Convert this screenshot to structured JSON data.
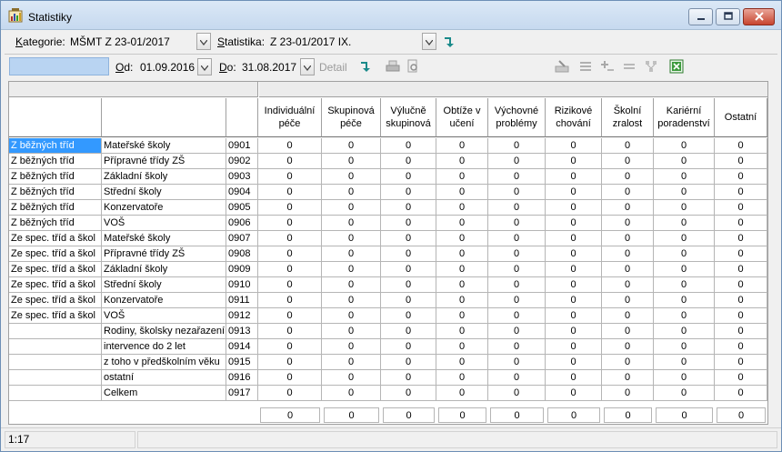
{
  "window": {
    "title": "Statistiky"
  },
  "filters": {
    "category_label": "Kategorie:",
    "category_value": "MŠMT Z 23-01/2017",
    "statistic_label": "Statistika:",
    "statistic_value": "Z 23-01/2017 IX."
  },
  "toolbar": {
    "from_label": "Od:",
    "from_value": "01.09.2016",
    "to_label": "Do:",
    "to_value": "31.08.2017",
    "detail_label": "Detail"
  },
  "table": {
    "columns": [
      "Individuální péče",
      "Skupinová péče",
      "Výlučně skupinová",
      "Obtíže v učení",
      "Výchovné problémy",
      "Rizikové chování",
      "Školní zralost",
      "Kariérní poradenství",
      "Ostatní"
    ],
    "rows": [
      {
        "group": "Z běžných tříd",
        "name": "Mateřské školy",
        "code": "0901",
        "values": [
          "0",
          "0",
          "0",
          "0",
          "0",
          "0",
          "0",
          "0",
          "0"
        ]
      },
      {
        "group": "Z běžných tříd",
        "name": "Přípravné třídy ZŠ",
        "code": "0902",
        "values": [
          "0",
          "0",
          "0",
          "0",
          "0",
          "0",
          "0",
          "0",
          "0"
        ]
      },
      {
        "group": "Z běžných tříd",
        "name": "Základní školy",
        "code": "0903",
        "values": [
          "0",
          "0",
          "0",
          "0",
          "0",
          "0",
          "0",
          "0",
          "0"
        ]
      },
      {
        "group": "Z běžných tříd",
        "name": "Střední školy",
        "code": "0904",
        "values": [
          "0",
          "0",
          "0",
          "0",
          "0",
          "0",
          "0",
          "0",
          "0"
        ]
      },
      {
        "group": "Z běžných tříd",
        "name": "Konzervatoře",
        "code": "0905",
        "values": [
          "0",
          "0",
          "0",
          "0",
          "0",
          "0",
          "0",
          "0",
          "0"
        ]
      },
      {
        "group": "Z běžných tříd",
        "name": "VOŠ",
        "code": "0906",
        "values": [
          "0",
          "0",
          "0",
          "0",
          "0",
          "0",
          "0",
          "0",
          "0"
        ]
      },
      {
        "group": "Ze spec. tříd a škol",
        "name": "Mateřské školy",
        "code": "0907",
        "values": [
          "0",
          "0",
          "0",
          "0",
          "0",
          "0",
          "0",
          "0",
          "0"
        ]
      },
      {
        "group": "Ze spec. tříd a škol",
        "name": "Přípravné třídy ZŠ",
        "code": "0908",
        "values": [
          "0",
          "0",
          "0",
          "0",
          "0",
          "0",
          "0",
          "0",
          "0"
        ]
      },
      {
        "group": "Ze spec. tříd a škol",
        "name": "Základní školy",
        "code": "0909",
        "values": [
          "0",
          "0",
          "0",
          "0",
          "0",
          "0",
          "0",
          "0",
          "0"
        ]
      },
      {
        "group": "Ze spec. tříd a škol",
        "name": "Střední školy",
        "code": "0910",
        "values": [
          "0",
          "0",
          "0",
          "0",
          "0",
          "0",
          "0",
          "0",
          "0"
        ]
      },
      {
        "group": "Ze spec. tříd a škol",
        "name": "Konzervatoře",
        "code": "0911",
        "values": [
          "0",
          "0",
          "0",
          "0",
          "0",
          "0",
          "0",
          "0",
          "0"
        ]
      },
      {
        "group": "Ze spec. tříd a škol",
        "name": "VOŠ",
        "code": "0912",
        "values": [
          "0",
          "0",
          "0",
          "0",
          "0",
          "0",
          "0",
          "0",
          "0"
        ]
      },
      {
        "group": "",
        "name": "Rodiny, školsky nezařazení",
        "code": "0913",
        "values": [
          "0",
          "0",
          "0",
          "0",
          "0",
          "0",
          "0",
          "0",
          "0"
        ]
      },
      {
        "group": "",
        "name": "intervence do 2 let",
        "code": "0914",
        "values": [
          "0",
          "0",
          "0",
          "0",
          "0",
          "0",
          "0",
          "0",
          "0"
        ]
      },
      {
        "group": "",
        "name": "z toho v předškolním věku",
        "code": "0915",
        "values": [
          "0",
          "0",
          "0",
          "0",
          "0",
          "0",
          "0",
          "0",
          "0"
        ]
      },
      {
        "group": "",
        "name": "ostatní",
        "code": "0916",
        "values": [
          "0",
          "0",
          "0",
          "0",
          "0",
          "0",
          "0",
          "0",
          "0"
        ]
      },
      {
        "group": "",
        "name": "Celkem",
        "code": "0917",
        "values": [
          "0",
          "0",
          "0",
          "0",
          "0",
          "0",
          "0",
          "0",
          "0"
        ]
      }
    ],
    "totals": [
      "0",
      "0",
      "0",
      "0",
      "0",
      "0",
      "0",
      "0",
      "0"
    ],
    "selected_row": 0
  },
  "status": {
    "position": "1:17"
  },
  "colors": {
    "selection": "#3399ff",
    "arrow_teal": "#1a8a8a"
  },
  "icons": [
    "app-statistics-icon",
    "minimize-icon",
    "maximize-icon",
    "close-icon",
    "go-arrow-icon",
    "print-icon",
    "print-preview-icon",
    "add-row-icon",
    "excel-export-icon"
  ]
}
